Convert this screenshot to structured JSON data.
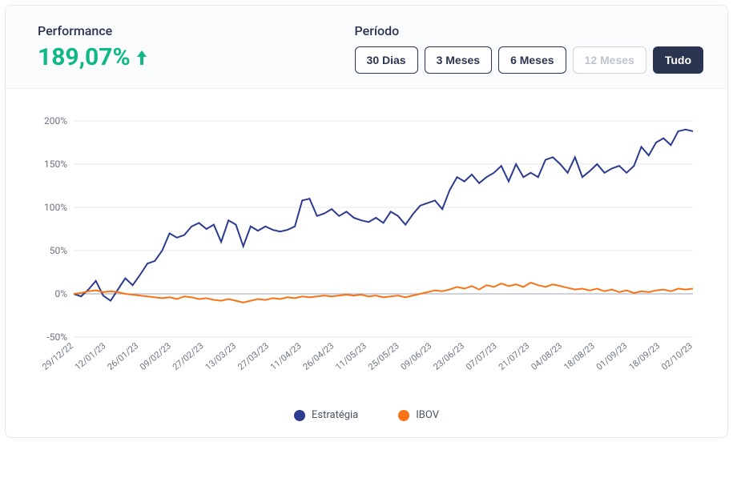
{
  "header": {
    "performance_label": "Performance",
    "performance_value": "189,07%",
    "period_label": "Período",
    "period_buttons": [
      {
        "label": "30 Dias",
        "state": "normal"
      },
      {
        "label": "3 Meses",
        "state": "normal"
      },
      {
        "label": "6 Meses",
        "state": "normal"
      },
      {
        "label": "12 Meses",
        "state": "disabled"
      },
      {
        "label": "Tudo",
        "state": "active"
      }
    ]
  },
  "legend": {
    "estrategia": "Estratégia",
    "ibov": "IBOV"
  },
  "colors": {
    "estrategia": "#2c3a8f",
    "ibov": "#f97316",
    "positive": "#10b981"
  },
  "chart_data": {
    "type": "line",
    "ylabel": "",
    "xlabel": "",
    "ylim": [
      -50,
      200
    ],
    "y_ticks": [
      "-50%",
      "0%",
      "50%",
      "100%",
      "150%",
      "200%"
    ],
    "x_ticks": [
      "29/12/22",
      "12/01/23",
      "26/01/23",
      "09/02/23",
      "27/02/23",
      "13/03/23",
      "27/03/23",
      "11/04/23",
      "26/04/23",
      "11/05/23",
      "25/05/23",
      "09/06/23",
      "23/06/23",
      "07/07/23",
      "21/07/23",
      "04/08/23",
      "18/08/23",
      "01/09/23",
      "18/09/23",
      "02/10/23"
    ],
    "series": [
      {
        "name": "Estratégia",
        "color": "#2c3a8f",
        "values": [
          0,
          -3,
          5,
          15,
          -2,
          -8,
          5,
          18,
          10,
          22,
          35,
          38,
          50,
          70,
          65,
          68,
          78,
          82,
          75,
          80,
          60,
          85,
          80,
          55,
          78,
          73,
          78,
          74,
          72,
          74,
          78,
          108,
          110,
          90,
          93,
          98,
          90,
          95,
          88,
          85,
          83,
          88,
          82,
          95,
          90,
          80,
          92,
          102,
          105,
          108,
          98,
          120,
          135,
          130,
          138,
          128,
          135,
          140,
          148,
          130,
          150,
          135,
          140,
          135,
          155,
          158,
          150,
          140,
          158,
          135,
          142,
          150,
          140,
          145,
          148,
          140,
          148,
          170,
          160,
          175,
          180,
          172,
          188,
          190,
          188
        ]
      },
      {
        "name": "IBOV",
        "color": "#f97316",
        "values": [
          0,
          1,
          3,
          4,
          2,
          3,
          2,
          0,
          -1,
          -2,
          -3,
          -4,
          -5,
          -4,
          -6,
          -3,
          -4,
          -6,
          -5,
          -7,
          -8,
          -6,
          -8,
          -10,
          -8,
          -6,
          -7,
          -5,
          -6,
          -4,
          -5,
          -3,
          -4,
          -3,
          -2,
          -3,
          -2,
          -1,
          -2,
          -1,
          -3,
          -2,
          -4,
          -3,
          -2,
          -4,
          -2,
          0,
          2,
          4,
          3,
          5,
          8,
          6,
          9,
          5,
          10,
          8,
          12,
          9,
          11,
          8,
          13,
          10,
          8,
          11,
          9,
          7,
          5,
          6,
          4,
          6,
          3,
          5,
          2,
          4,
          1,
          3,
          2,
          4,
          5,
          3,
          6,
          5,
          6
        ]
      }
    ]
  }
}
